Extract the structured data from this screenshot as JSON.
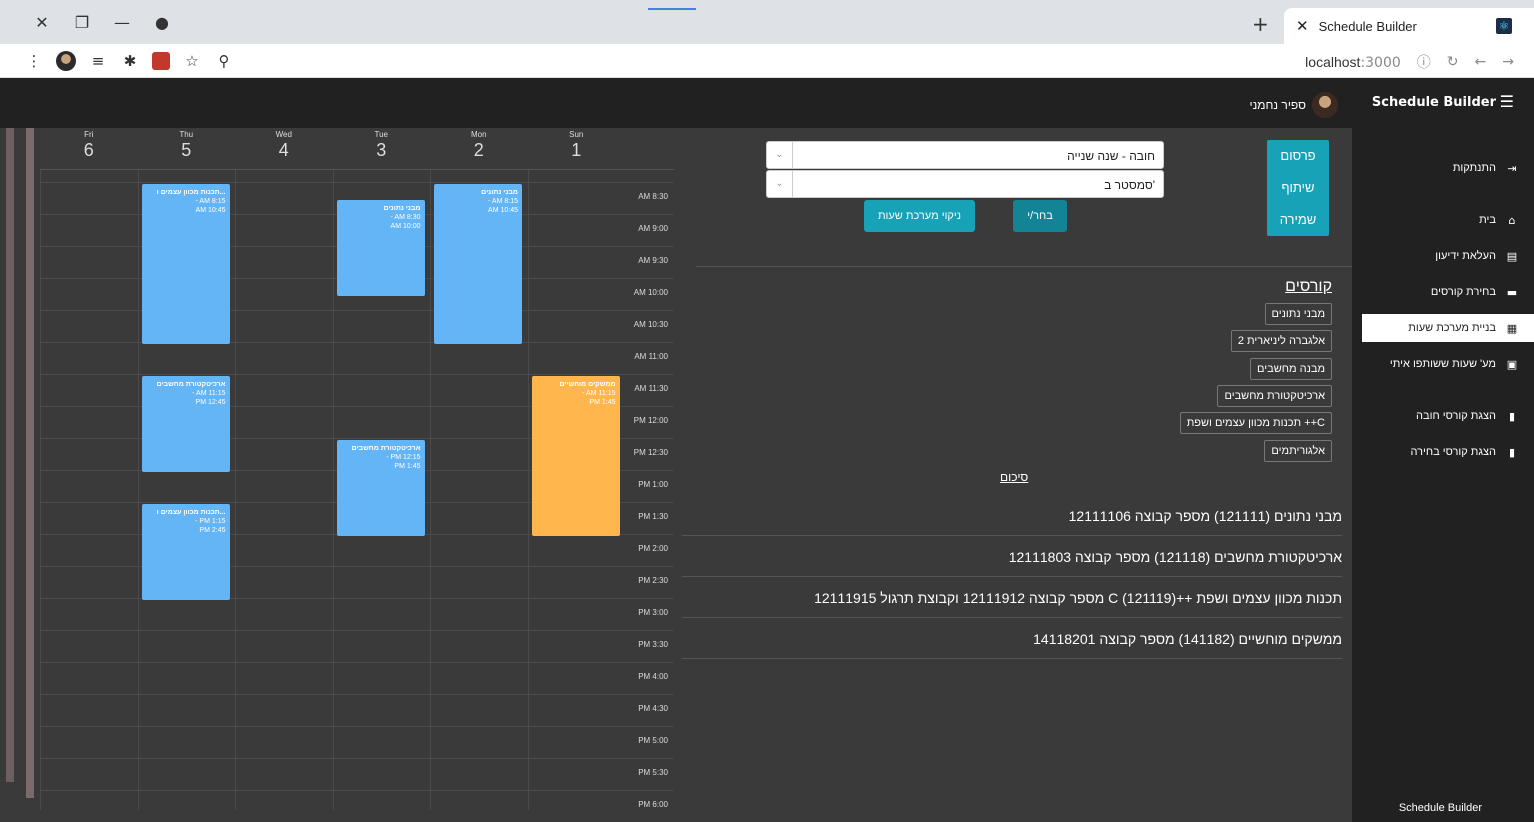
{
  "browser": {
    "tab_title": "Schedule Builder",
    "url_host": "localhost",
    "url_port": ":3000"
  },
  "appbar": {
    "brand": "Schedule Builder",
    "user_name": "ספיר נחמני"
  },
  "sidebar": {
    "items": [
      {
        "label": "התנתקות",
        "icon": "sign-out-icon"
      },
      {
        "label": "בית",
        "icon": "home-icon"
      },
      {
        "label": "העלאת ידיעון",
        "icon": "file-upload-icon"
      },
      {
        "label": "בחירת קורסים",
        "icon": "archive-icon"
      },
      {
        "label": "בניית מערכת שעות",
        "icon": "calendar-icon"
      },
      {
        "label": "מע' שעות ששותפו איתי",
        "icon": "calendar-shared-icon"
      },
      {
        "label": "הצגת קורסי חובה",
        "icon": "bookmark-icon"
      },
      {
        "label": "הצגת קורסי בחירה",
        "icon": "bookmark-icon"
      }
    ],
    "footer": "Schedule Builder"
  },
  "calendar": {
    "days": [
      {
        "name": "Sun",
        "num": "1"
      },
      {
        "name": "Mon",
        "num": "2"
      },
      {
        "name": "Tue",
        "num": "3"
      },
      {
        "name": "Wed",
        "num": "4"
      },
      {
        "name": "Thu",
        "num": "5"
      },
      {
        "name": "Fri",
        "num": "6"
      }
    ],
    "times": [
      "8:30 AM",
      "9:00 AM",
      "9:30 AM",
      "10:00 AM",
      "10:30 AM",
      "11:00 AM",
      "11:30 AM",
      "12:00 PM",
      "12:30 PM",
      "1:00 PM",
      "1:30 PM",
      "2:00 PM",
      "2:30 PM",
      "3:00 PM",
      "3:30 PM",
      "4:00 PM",
      "4:30 PM",
      "5:00 PM",
      "5:30 PM",
      "6:00 PM"
    ],
    "events": [
      {
        "day": 1,
        "title": "מבני נתונים",
        "time": "8:15 AM - 10:45 AM",
        "start": 8.25,
        "end": 10.75,
        "color": "blue"
      },
      {
        "day": 2,
        "title": "מבני נתונים",
        "time": "8:30 AM - 10:00 AM",
        "start": 8.5,
        "end": 10.0,
        "color": "blue"
      },
      {
        "day": 4,
        "title": "תכנות מכוון עצמים ו...",
        "time": "8:15 AM - 10:45 AM",
        "start": 8.25,
        "end": 10.75,
        "color": "blue"
      },
      {
        "day": 0,
        "title": "ממשקים מוחשיים",
        "time": "11:15 AM - 1:45 PM",
        "start": 11.25,
        "end": 13.75,
        "color": "orange"
      },
      {
        "day": 4,
        "title": "ארכיטקטורת מחשבים",
        "time": "11:15 AM - 12:45 PM",
        "start": 11.25,
        "end": 12.75,
        "color": "blue"
      },
      {
        "day": 2,
        "title": "ארכיטקטורת מחשבים",
        "time": "12:15 PM - 1:45 PM",
        "start": 12.25,
        "end": 13.75,
        "color": "blue"
      },
      {
        "day": 4,
        "title": "תכנות מכוון עצמים ו...",
        "time": "1:15 PM - 2:45 PM",
        "start": 13.25,
        "end": 14.75,
        "color": "blue"
      }
    ]
  },
  "main": {
    "actions": [
      "פרסום",
      "שיתוף",
      "שמירה"
    ],
    "select_year": "חובה - שנה שנייה",
    "select_semester": "סמסטר ב'",
    "choose_button": "בחר/י",
    "clear_button": "ניקוי מערכת שעות",
    "courses_title": "קורסים",
    "courses": [
      "מבני נתונים",
      "אלגברה ליניארית 2",
      "מבנה מחשבים",
      "ארכיטקטורת מחשבים",
      "תכנות מכוון עצמים ושפת ++C",
      "אלגוריתמים"
    ],
    "summary_title": "סיכום",
    "summary": [
      "מבני נתונים (121111) מספר קבוצה 12111106",
      "ארכיטקטורת מחשבים (121118) מספר קבוצה 12111803",
      "תכנות מכוון עצמים ושפת ++C (121119) מספר קבוצה 12111912 וקבוצת תרגול 12111915",
      "ממשקים מוחשיים (141182) מספר קבוצה 14118201"
    ]
  },
  "colors": {
    "event_blue": "#64b5f6",
    "event_orange": "#ffb74d",
    "accent_teal": "#17a2b8"
  }
}
